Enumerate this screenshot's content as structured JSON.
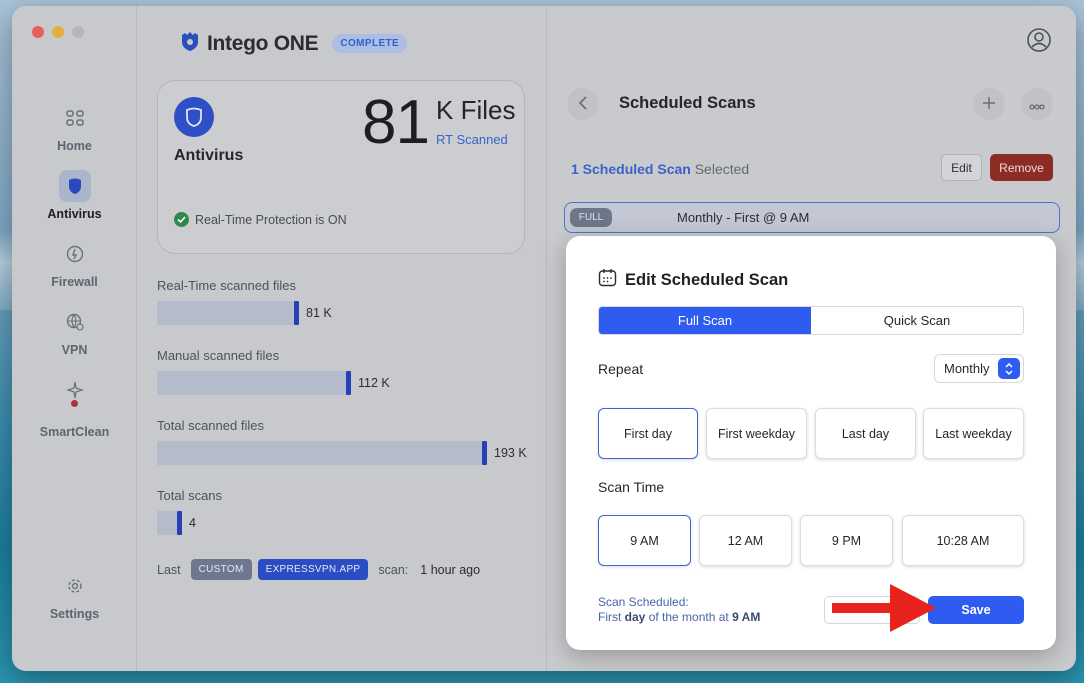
{
  "window": {
    "traffic_lights": [
      "close",
      "minimize",
      "zoom"
    ]
  },
  "sidebar": {
    "items": [
      {
        "label": "Home",
        "icon": "home-icon"
      },
      {
        "label": "Antivirus",
        "icon": "shield-icon",
        "active": true
      },
      {
        "label": "Firewall",
        "icon": "firewall-icon"
      },
      {
        "label": "VPN",
        "icon": "vpn-globe-icon"
      },
      {
        "label": "SmartClean",
        "icon": "sparkle-icon",
        "alert": true
      },
      {
        "label": "Settings",
        "icon": "gear-icon"
      }
    ]
  },
  "brand": {
    "name": "Intego ONE",
    "badge": "COMPLETE"
  },
  "antivirus_card": {
    "title": "Antivirus",
    "big_number": "81",
    "unit": "K Files",
    "sub": "RT Scanned",
    "status": "Real-Time Protection is ON"
  },
  "stats": [
    {
      "label": "Real-Time scanned files",
      "value": "81 K",
      "fraction": 0.42
    },
    {
      "label": "Manual scanned files",
      "value": "112 K",
      "fraction": 0.58
    },
    {
      "label": "Total scanned files",
      "value": "193 K",
      "fraction": 1.0
    },
    {
      "label": "Total scans",
      "value": "4",
      "fraction": 0.06
    }
  ],
  "last_scan": {
    "prefix": "Last",
    "tag1": "CUSTOM",
    "tag2": "EXPRESSVPN.APP",
    "suffix": "scan:",
    "time": "1 hour ago"
  },
  "right_panel": {
    "title": "Scheduled Scans",
    "selected_count_text": "1 Scheduled Scan",
    "selected_suffix": "Selected",
    "edit_label": "Edit",
    "remove_label": "Remove",
    "schedule_row": {
      "tag": "FULL",
      "text": "Monthly - First @ 9 AM"
    }
  },
  "modal": {
    "title": "Edit Scheduled Scan",
    "scan_types": [
      "Full Scan",
      "Quick Scan"
    ],
    "selected_scan_type": "Full Scan",
    "repeat_label": "Repeat",
    "repeat_value": "Monthly",
    "day_options": [
      "First day",
      "First weekday",
      "Last day",
      "Last weekday"
    ],
    "selected_day": "First day",
    "scan_time_label": "Scan Time",
    "time_options": [
      "9 AM",
      "12 AM",
      "9 PM",
      "10:28 AM"
    ],
    "selected_time": "9 AM",
    "note_line1": "Scan Scheduled:",
    "note_first": "First",
    "note_day": "day",
    "note_mid": "of the month at",
    "note_time": "9 AM",
    "save_label": "Save"
  },
  "colors": {
    "accent": "#2f5cf0",
    "remove": "#8b2d25",
    "arrow": "#e8231d"
  }
}
